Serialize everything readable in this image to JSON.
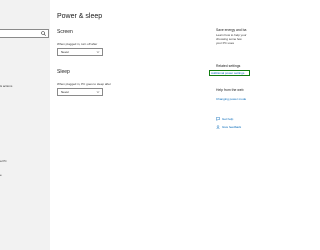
{
  "sidebar": {
    "search_placeholder": "",
    "items": [
      {
        "label": "& actions"
      },
      {
        "label": "a PC"
      },
      {
        "label": "e"
      }
    ]
  },
  "main": {
    "title": "Power & sleep",
    "screen": {
      "heading": "Screen",
      "label": "When plugged in, turn off after",
      "value": "Never"
    },
    "sleep": {
      "heading": "Sleep",
      "label": "When plugged in, PC goes to sleep after",
      "value": "Never"
    }
  },
  "right_panel": {
    "save_energy": {
      "heading": "Save energy and ba",
      "lines": [
        "Learn how to help your",
        "choosing some few",
        "your PC uses"
      ]
    },
    "related": {
      "heading": "Related settings",
      "link": "Additional power settings"
    },
    "help": {
      "heading": "Help from the web",
      "link": "Changing power mode"
    },
    "get_help": "Get help",
    "give_feedback": "Give feedback"
  },
  "colors": {
    "sidebar_bg": "#f2f2f2",
    "link": "#0067b8",
    "focus_outline": "#107c10"
  }
}
